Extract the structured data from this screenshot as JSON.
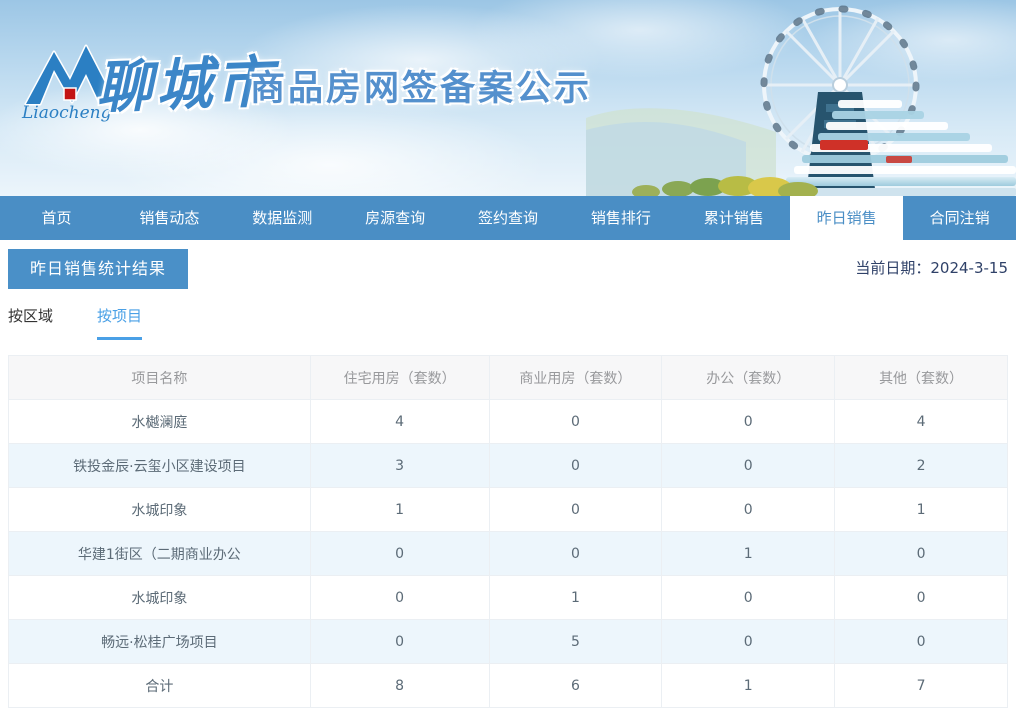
{
  "banner": {
    "logo_script": "Liaocheng",
    "logo_city": "聊城市",
    "title": "商品房网签备案公示"
  },
  "nav": {
    "items": [
      {
        "label": "首页",
        "active": false
      },
      {
        "label": "销售动态",
        "active": false
      },
      {
        "label": "数据监测",
        "active": false
      },
      {
        "label": "房源查询",
        "active": false
      },
      {
        "label": "签约查询",
        "active": false
      },
      {
        "label": "销售排行",
        "active": false
      },
      {
        "label": "累计销售",
        "active": false
      },
      {
        "label": "昨日销售",
        "active": true
      },
      {
        "label": "合同注销",
        "active": false
      }
    ]
  },
  "page": {
    "section_title": "昨日销售统计结果",
    "date_label": "当前日期：2024-3-15"
  },
  "tabs": [
    {
      "label": "按区域",
      "active": false
    },
    {
      "label": "按项目",
      "active": true
    }
  ],
  "table": {
    "headers": [
      "项目名称",
      "住宅用房（套数）",
      "商业用房（套数）",
      "办公（套数）",
      "其他（套数）"
    ],
    "rows": [
      {
        "name": "水樾澜庭",
        "values": [
          "4",
          "0",
          "0",
          "4"
        ]
      },
      {
        "name": "铁投金辰·云玺小区建设项目",
        "values": [
          "3",
          "0",
          "0",
          "2"
        ]
      },
      {
        "name": "水城印象",
        "values": [
          "1",
          "0",
          "0",
          "1"
        ]
      },
      {
        "name": "华建1街区（二期商业办公",
        "values": [
          "0",
          "0",
          "1",
          "0"
        ]
      },
      {
        "name": "水城印象",
        "values": [
          "0",
          "1",
          "0",
          "0"
        ]
      },
      {
        "name": "畅远·松桂广场项目",
        "values": [
          "0",
          "5",
          "0",
          "0"
        ]
      },
      {
        "name": "合计",
        "values": [
          "8",
          "6",
          "1",
          "7"
        ]
      }
    ]
  },
  "colors": {
    "nav_blue": "#4a8ec5",
    "badge_blue": "#4a90c8",
    "tab_active_blue": "#4aa0e6",
    "date_navy": "#2f4168",
    "header_row_bg": "#f7f7f8",
    "alt_row_bg": "#edf6fc",
    "logo_blue": "#2b7fc3",
    "logo_red": "#c31414"
  }
}
